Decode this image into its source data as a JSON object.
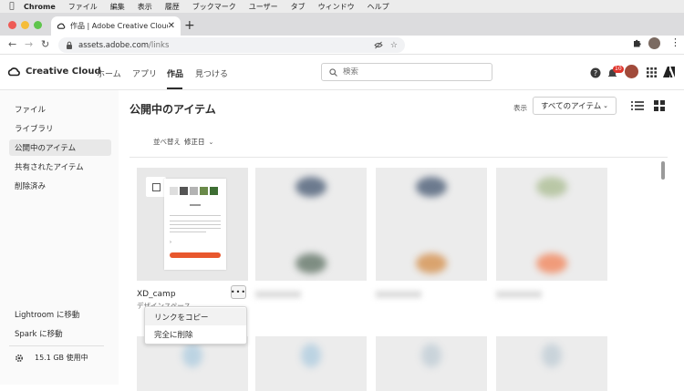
{
  "macos_menu": {
    "app_name": "Chrome",
    "items": [
      "ファイル",
      "編集",
      "表示",
      "履歴",
      "ブックマーク",
      "ユーザー",
      "タブ",
      "ウィンドウ",
      "ヘルプ"
    ]
  },
  "browser": {
    "tab_title": "作品 | Adobe Creative Cloud",
    "url_domain": "assets.adobe.com",
    "url_path": "/links"
  },
  "header": {
    "brand": "Creative Cloud",
    "nav": [
      "ホーム",
      "アプリ",
      "作品",
      "見つける"
    ],
    "active_nav_index": 2,
    "search_placeholder": "検索",
    "notification_count": "10"
  },
  "sidebar": {
    "items": [
      "ファイル",
      "ライブラリ",
      "公開中のアイテム",
      "共有されたアイテム",
      "削除済み"
    ],
    "selected_index": 2,
    "bottom_links": [
      "Lightroom に移動",
      "Spark に移動"
    ],
    "storage": "15.1 GB 使用中"
  },
  "main": {
    "title": "公開中のアイテム",
    "view_label": "表示",
    "view_value": "すべてのアイテム",
    "sort_label": "並べ替え",
    "sort_value": "修正日"
  },
  "card": {
    "name": "XD_camp",
    "subtitle": "デザインスペース"
  },
  "context_menu": {
    "items": [
      "リンクをコピー",
      "完全に削除"
    ]
  },
  "colors": {
    "accent_orange": "#e8572d",
    "badge_red": "#e0342c"
  }
}
